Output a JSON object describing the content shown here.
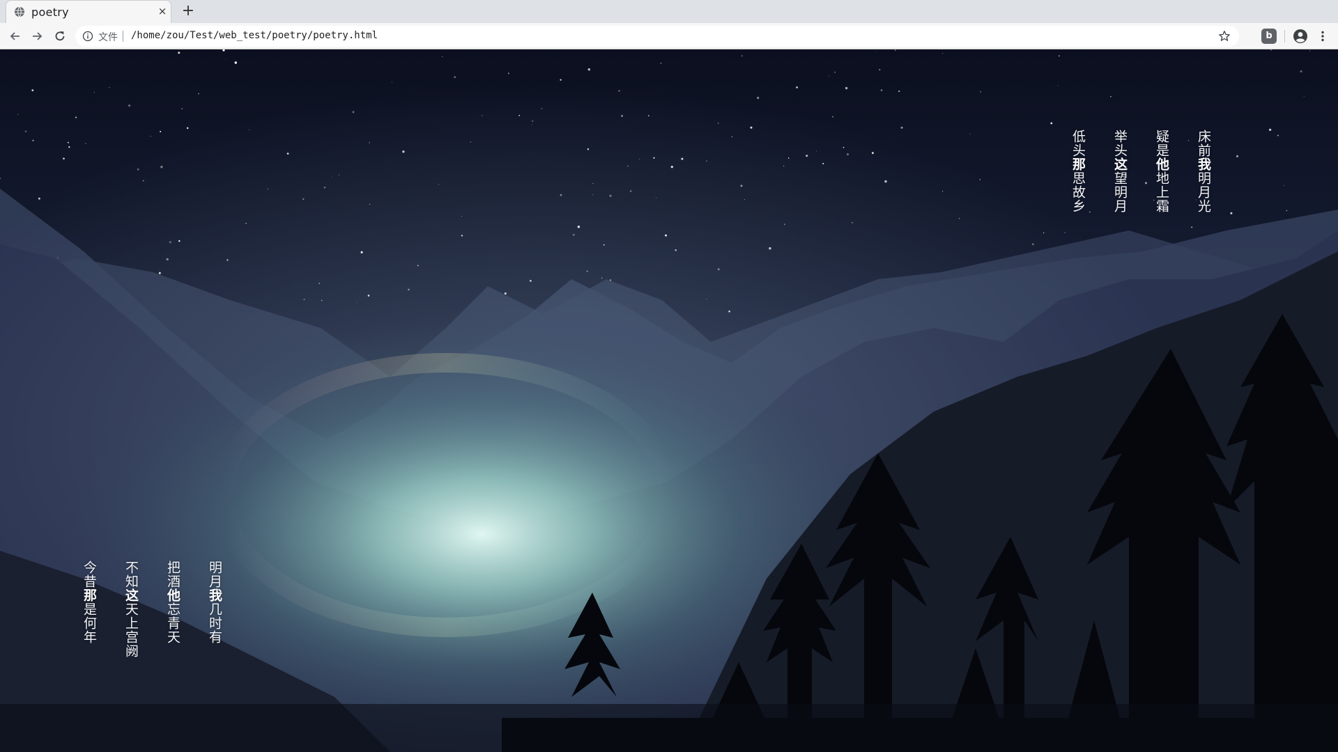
{
  "browser": {
    "tab_title": "poetry",
    "tab_close": "×",
    "new_tab": "+",
    "url_scheme_label": "文件",
    "url": "/home/zou/Test/web_test/poetry/poetry.html",
    "extension_label": "b"
  },
  "icons": {
    "favicon": "globe-icon",
    "back": "arrow-left-icon",
    "forward": "arrow-right-icon",
    "reload": "reload-icon",
    "site_info": "info-icon",
    "bookmark": "star-icon",
    "extension": "extension-b-icon",
    "profile": "account-circle-icon",
    "menu": "kebab-menu-icon"
  },
  "poem_top": {
    "columns": [
      {
        "pre": "床前",
        "emph": "我",
        "post": "明月光"
      },
      {
        "pre": "疑是",
        "emph": "他",
        "post": "地上霜"
      },
      {
        "pre": "举头",
        "emph": "这",
        "post": "望明月"
      },
      {
        "pre": "低头",
        "emph": "那",
        "post": "思故乡"
      }
    ]
  },
  "poem_bottom": {
    "columns": [
      {
        "pre": "明月",
        "emph": "我",
        "post": "几时有"
      },
      {
        "pre": "把酒",
        "emph": "他",
        "post": "忘青天"
      },
      {
        "pre": "不知",
        "emph": "这",
        "post": "天上宫阙"
      },
      {
        "pre": "今昔",
        "emph": "那",
        "post": "是何年"
      }
    ]
  },
  "colors": {
    "sky_top": "#0b0f1f",
    "sky_mid": "#1f2740",
    "mountain_far": "#3a4560",
    "mountain_mid": "#2b3550",
    "lake_glow": "#c9efe6",
    "tree_dark": "#05070c"
  }
}
